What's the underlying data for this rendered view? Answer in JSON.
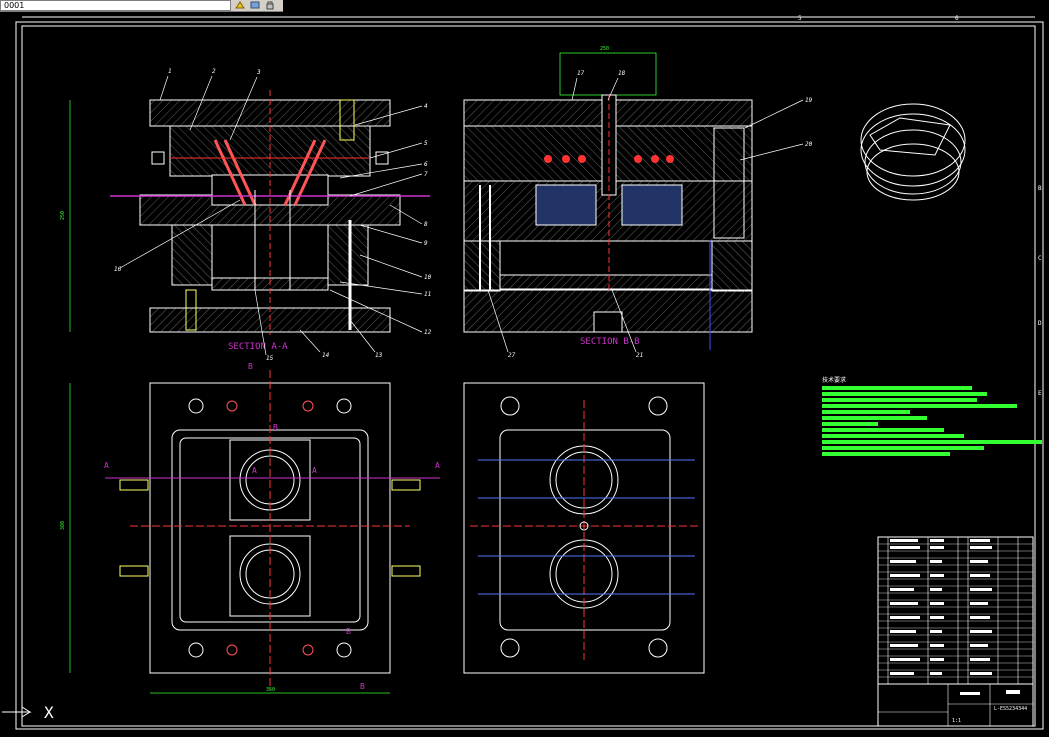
{
  "toolbar": {
    "layer_value": "0001",
    "icons": [
      "layer-state-icon",
      "layer-freeze-icon",
      "layer-lock-icon"
    ]
  },
  "drawing": {
    "colors": {
      "background": "#000000",
      "frame": "#ffffff",
      "callout": "#ffffff",
      "section_label": "#cc33cc",
      "centerline": "#ff3333",
      "dimension": "#33ff33",
      "bolt": "#ffff66"
    },
    "top_column_labels": [
      "5",
      "6"
    ],
    "right_row_labels": [
      "B",
      "C",
      "D",
      "E"
    ],
    "section_labels": [
      "SECTION A-A",
      "SECTION B-B"
    ],
    "section_letters": [
      "A",
      "A",
      "A",
      "A",
      "B",
      "B",
      "B",
      "B"
    ],
    "callouts_left": [
      "1",
      "2",
      "3",
      "4",
      "5",
      "6",
      "7",
      "8",
      "9",
      "10",
      "11",
      "12",
      "13",
      "14",
      "15",
      "16"
    ],
    "callouts_right": [
      "17",
      "18",
      "19",
      "20",
      "21",
      "27"
    ],
    "dimensions": [
      "250",
      "380",
      "350",
      "250"
    ],
    "notes_title": "技术要求",
    "title_block": {
      "drawing_number": "L-ES5234344",
      "scale_row": "1:1"
    },
    "ucs_label": "X"
  }
}
